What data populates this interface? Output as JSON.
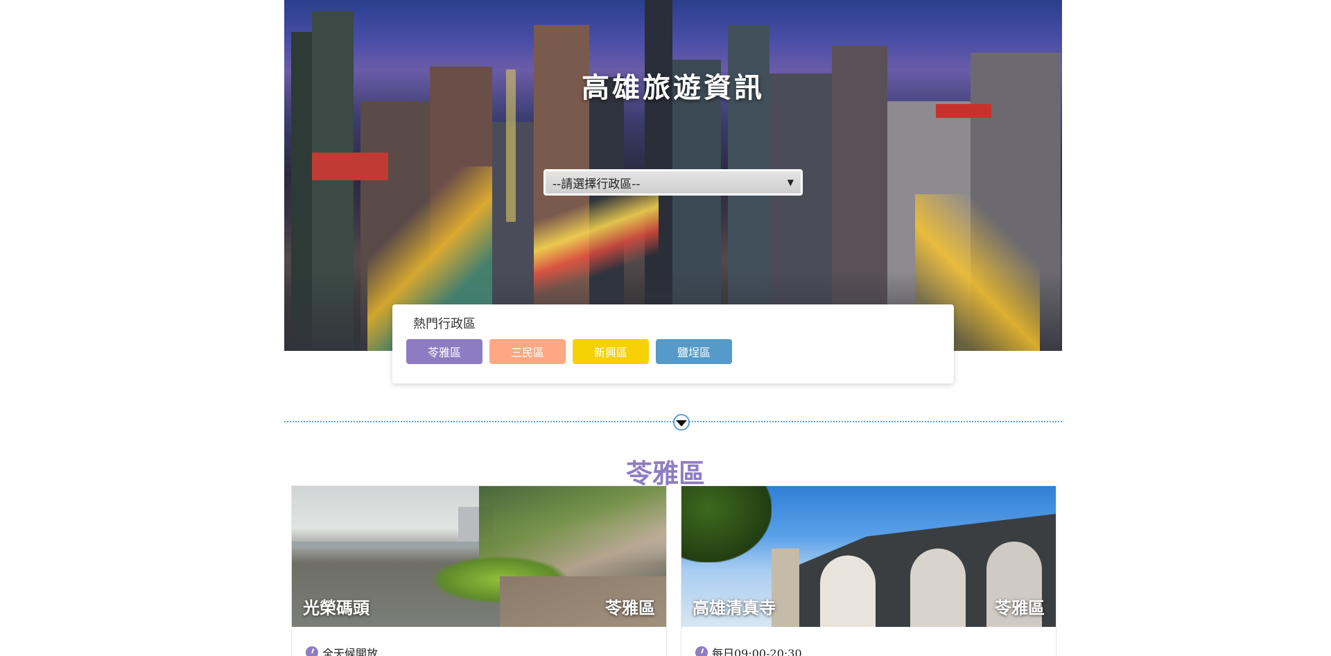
{
  "hero": {
    "title": "高雄旅遊資訊",
    "select_placeholder": "--請選擇行政區--",
    "select_arrow": "▼"
  },
  "popular": {
    "title": "熱門行政區",
    "districts": [
      {
        "label": "苓雅區",
        "color": "#8e7cc3"
      },
      {
        "label": "三民區",
        "color": "#ffa782"
      },
      {
        "label": "新興區",
        "color": "#f5d105"
      },
      {
        "label": "鹽埕區",
        "color": "#559ac8"
      }
    ]
  },
  "section": {
    "title": "苓雅區",
    "title_color": "#8e7cc3"
  },
  "cards": [
    {
      "name": "光榮碼頭",
      "district": "苓雅區",
      "hours": "全天候開放",
      "icon": "clock-icon"
    },
    {
      "name": "高雄清真寺",
      "district": "苓雅區",
      "hours": "每日09:00-20:30",
      "icon": "clock-icon"
    }
  ],
  "colors": {
    "divider": "#5a9fd4",
    "accent": "#8e7cc3"
  }
}
